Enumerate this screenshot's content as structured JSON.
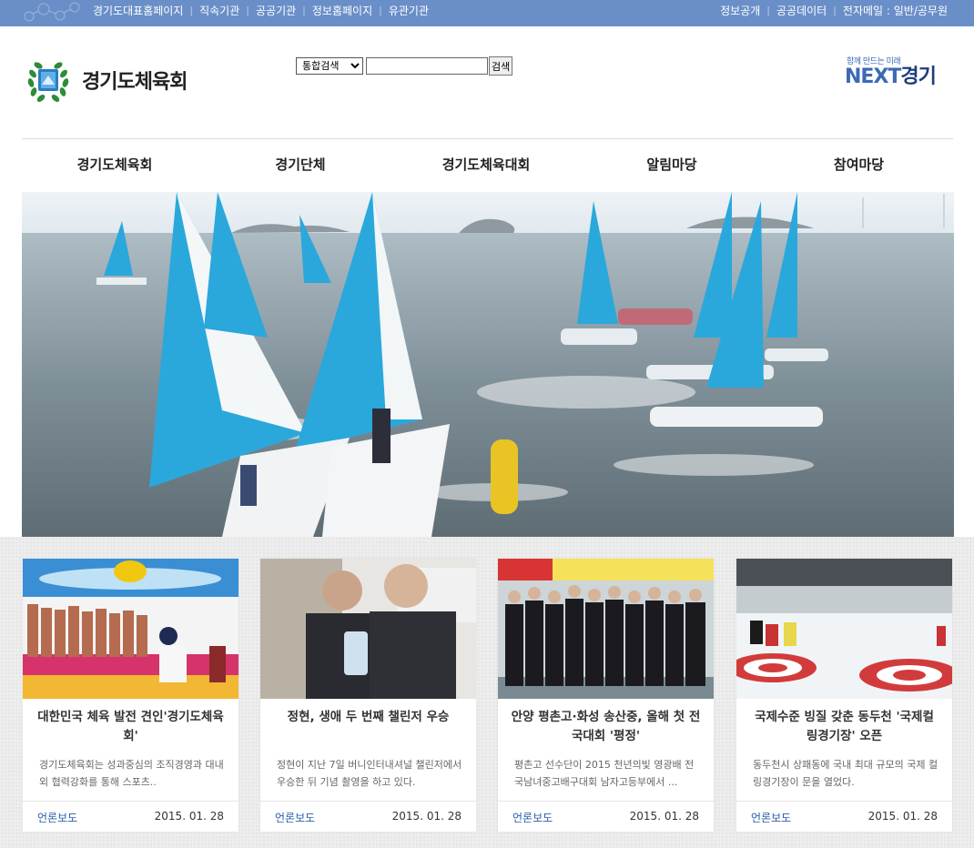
{
  "topbar": {
    "left_links": [
      "경기도대표홈페이지",
      "직속기관",
      "공공기관",
      "정보홈페이지",
      "유관기관"
    ],
    "right_links": [
      "정보공개",
      "공공데이터",
      "전자메일 : 일반/공무원"
    ]
  },
  "header": {
    "logo_text": "경기도체육회",
    "search_select": "통합검색",
    "search_button": "검색",
    "next_slogan": "함께 만드는 미래",
    "next_brand": "NEXT",
    "next_brand2": "경기"
  },
  "gnb": [
    "경기도체육회",
    "경기단체",
    "경기도체육대회",
    "알림마당",
    "참여마당"
  ],
  "news": [
    {
      "title": "대한민국 체육 발전 견인'경기도체육회'",
      "desc": "경기도체육회는 성과중심의 조직경영과 대내외 협력강화를 통해 스포츠..",
      "category": "언론보도",
      "date": "2015. 01. 28"
    },
    {
      "title": "정현, 생애 두 번째 챌린저 우승",
      "desc": "정현이 지난 7일 버니인터내셔널 챌린저에서 우승한 뒤 기념 촬영을 하고 있다.",
      "category": "언론보도",
      "date": "2015. 01. 28"
    },
    {
      "title": "안양 평촌고·화성 송산중, 올해 첫 전국대회 '평정'",
      "desc": "평촌고 선수단이 2015 천년의빛 영광배 전국남녀중고배구대회 남자고등부에서 ...",
      "category": "언론보도",
      "date": "2015. 01. 28"
    },
    {
      "title": "국제수준 빙질 갖춘 동두천 '국제컬링경기장' 오픈",
      "desc": "동두천시 상패동에 국내 최대 규모의 국제 컬링경기장이 문을 열었다.",
      "category": "언론보도",
      "date": "2015. 01. 28"
    }
  ],
  "colors": {
    "topbar": "#6a8fc8",
    "sail": "#2aa8dc",
    "link": "#2a5ea8"
  }
}
